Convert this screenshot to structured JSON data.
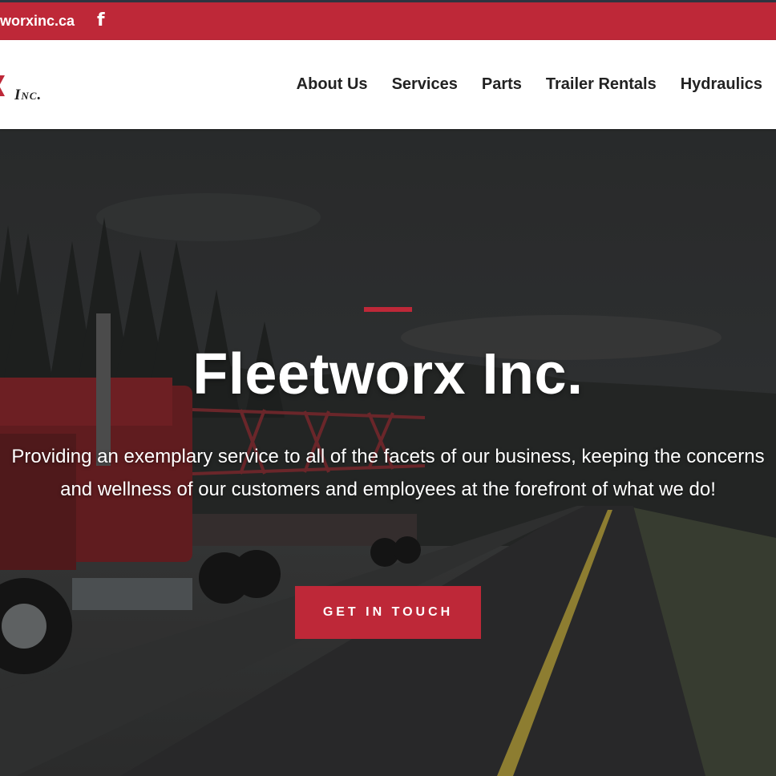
{
  "topbar": {
    "email": "worxinc.ca",
    "facebook_icon": "facebook-icon",
    "bg_color": "#be2838"
  },
  "header": {
    "logo_text": "Inc.",
    "logo_mark_icon": "logo-x-mark",
    "nav": [
      {
        "label": "About Us"
      },
      {
        "label": "Services"
      },
      {
        "label": "Parts"
      },
      {
        "label": "Trailer Rentals"
      },
      {
        "label": "Hydraulics"
      }
    ]
  },
  "hero": {
    "title": "Fleetworx Inc.",
    "subtitle": "Providing an exemplary service to all of the facets of our business, keeping the concerns and wellness of our customers and employees at the forefront of what we do!",
    "cta_label": "GET IN TOUCH",
    "accent_color": "#be2838",
    "background_image": "red semi-truck with flatbed trailer on highway, forest at dusk"
  }
}
